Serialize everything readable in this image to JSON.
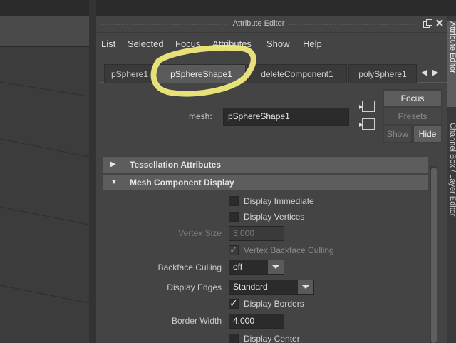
{
  "editor": {
    "title": "Attribute Editor",
    "float_icon": "float-window-icon",
    "close_icon": "close-icon"
  },
  "menu": [
    "List",
    "Selected",
    "Focus",
    "Attributes",
    "Show",
    "Help"
  ],
  "tabs": {
    "items": [
      {
        "label": "pSphere1",
        "active": false
      },
      {
        "label": "pSphereShape1",
        "active": true
      },
      {
        "label": "deleteComponent1",
        "active": false
      },
      {
        "label": "polySphere1",
        "active": false
      }
    ],
    "prev_icon": "arrow-left-icon",
    "next_icon": "arrow-right-icon"
  },
  "mesh": {
    "label": "mesh:",
    "value": "pSphereShape1",
    "load_icon": "load-selected-icon",
    "go_icon": "go-to-output-icon"
  },
  "buttons": {
    "focus": "Focus",
    "presets": "Presets",
    "show": "Show",
    "hide": "Hide"
  },
  "sections": {
    "tessellation": {
      "title": "Tessellation Attributes",
      "expanded": false
    },
    "mesh_component": {
      "title": "Mesh Component Display",
      "expanded": true
    }
  },
  "mesh_component": {
    "display_immediate": {
      "label": "Display Immediate",
      "checked": false
    },
    "display_vertices": {
      "label": "Display Vertices",
      "checked": false
    },
    "vertex_size": {
      "label": "Vertex Size",
      "value": "3.000",
      "disabled": true
    },
    "vertex_backface_culling": {
      "label": "Vertex Backface Culling",
      "checked": true,
      "disabled": true
    },
    "backface_culling": {
      "label": "Backface Culling",
      "value": "off"
    },
    "display_edges": {
      "label": "Display Edges",
      "value": "Standard"
    },
    "display_borders": {
      "label": "Display Borders",
      "checked": true
    },
    "border_width": {
      "label": "Border Width",
      "value": "4.000"
    },
    "display_center": {
      "label": "Display Center",
      "checked": false
    }
  },
  "side_tabs": {
    "attribute_editor": "Attribute Editor",
    "channel_box": "Channel Box / Layer Editor"
  },
  "colors": {
    "highlight": "#f0ea7a",
    "panel_bg": "#444444",
    "section_header": "#5d5d5d"
  }
}
